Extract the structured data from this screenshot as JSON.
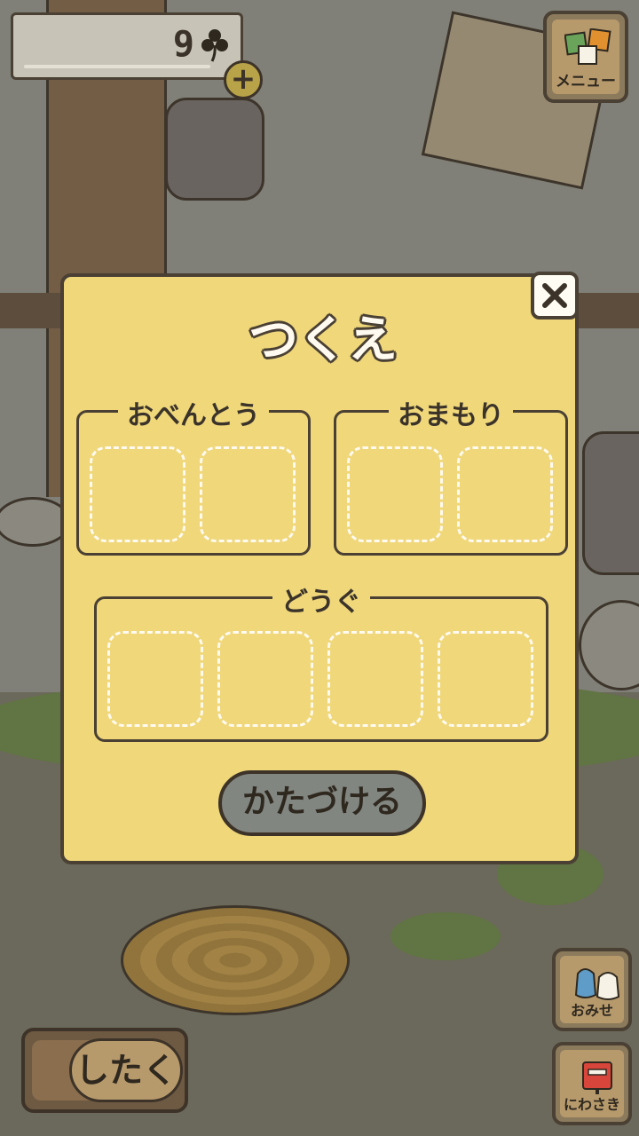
{
  "hud": {
    "clover_count": "9",
    "clover_icon": "clover-icon",
    "add_icon": "plus-icon",
    "menu_label": "メニュー",
    "menu_icon": "menu-squares-icon"
  },
  "dialog": {
    "title": "つくえ",
    "close_icon": "close-icon",
    "groups": {
      "lunch": {
        "label": "おべんとう",
        "slots": 2
      },
      "charm": {
        "label": "おまもり",
        "slots": 2
      },
      "tools": {
        "label": "どうぐ",
        "slots": 4
      }
    },
    "clear_label": "かたづける"
  },
  "side_buttons": {
    "shop_label": "おみせ",
    "shop_icon": "shop-bag-icon",
    "garden_label": "にわさき",
    "garden_icon": "mailbox-icon"
  },
  "prepare_label": "したく",
  "colors": {
    "dialog_bg": "#efd77a",
    "outline": "#4a4034",
    "slot_dash": "#fffaf0",
    "clear_button": "#828680",
    "wood": "#b79a6c"
  }
}
